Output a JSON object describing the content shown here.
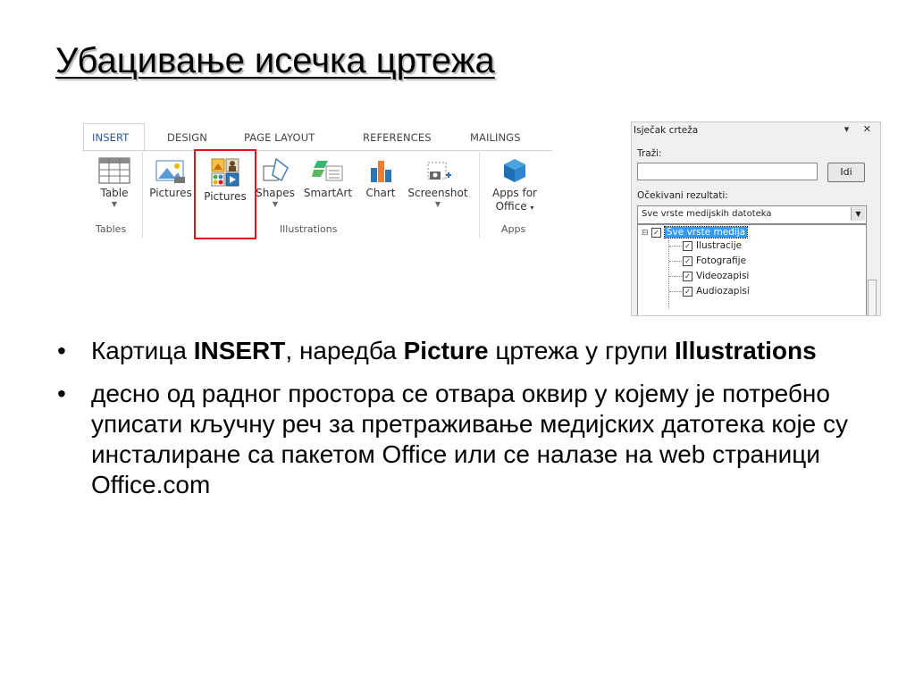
{
  "title": "Убацивање исечка цртежа",
  "ribbon": {
    "tabs": [
      "INSERT",
      "DESIGN",
      "PAGE LAYOUT",
      "REFERENCES",
      "MAILINGS"
    ],
    "buttons": {
      "table": "Table",
      "pictures": "Pictures",
      "online_pictures": "Pictures",
      "shapes": "Shapes",
      "smartart": "SmartArt",
      "chart": "Chart",
      "screenshot": "Screenshot",
      "apps_line1": "Apps for",
      "apps_line2": "Office"
    },
    "groups": {
      "tables": "Tables",
      "illustrations": "Illustrations",
      "apps": "Apps"
    }
  },
  "pane": {
    "title": "Isječak crteža",
    "controls": "▾ ✕",
    "search_label": "Traži:",
    "search_value": "",
    "go_button": "Idi",
    "results_label": "Očekivani rezultati:",
    "results_value": "Sve vrste medijskih datoteka",
    "tree": {
      "root": "Sve vrste medija",
      "children": [
        "Ilustracije",
        "Fotografije",
        "Videozapisi",
        "Audiozapisi"
      ]
    }
  },
  "bullets": [
    {
      "parts": [
        {
          "text": "Картица  ",
          "bold": false
        },
        {
          "text": "INSERT",
          "bold": true
        },
        {
          "text": ", наредба ",
          "bold": false
        },
        {
          "text": "Picture",
          "bold": true
        },
        {
          "text": " цртежа у групи ",
          "bold": false
        },
        {
          "text": "Illustrations",
          "bold": true
        }
      ]
    },
    {
      "parts": [
        {
          "text": "десно од радног простора се отвара оквир у којему је потребно уписати кључну реч за претраживање медијских датотека које су инсталиране са пакетом Office или се налазе на web страници Office.com",
          "bold": false
        }
      ]
    }
  ],
  "colors": {
    "active_tab": "#2b579a",
    "highlight_border": "#e8121a",
    "selection": "#3399ff"
  }
}
